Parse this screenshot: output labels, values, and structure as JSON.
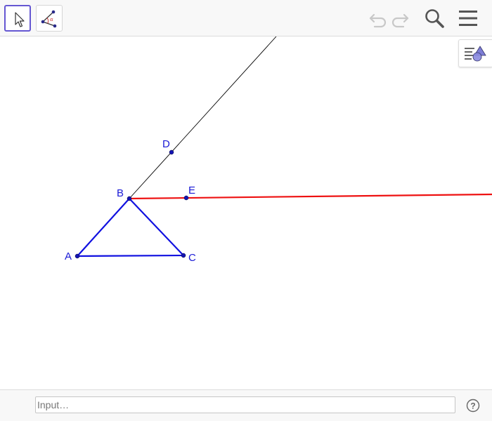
{
  "toolbar": {
    "tools": [
      {
        "name": "move",
        "icon": "arrow-cursor-icon",
        "selected": true
      },
      {
        "name": "angle",
        "icon": "angle-tool-icon",
        "selected": false
      }
    ],
    "actions": [
      {
        "name": "undo",
        "icon": "undo-icon"
      },
      {
        "name": "redo",
        "icon": "redo-icon"
      },
      {
        "name": "search",
        "icon": "search-icon"
      },
      {
        "name": "menu",
        "icon": "hamburger-menu-icon"
      }
    ]
  },
  "style_bar_toggle": {
    "icon": "style-bar-icon"
  },
  "construction": {
    "points": {
      "A": {
        "label": "A"
      },
      "B": {
        "label": "B"
      },
      "C": {
        "label": "C"
      },
      "D": {
        "label": "D"
      },
      "E": {
        "label": "E"
      }
    },
    "objects": [
      {
        "type": "polygon",
        "vertices": [
          "A",
          "B",
          "C"
        ],
        "color": "#1010e0"
      },
      {
        "type": "ray",
        "from": "B",
        "through": "D",
        "color": "#000000"
      },
      {
        "type": "ray",
        "from": "B",
        "through": "E",
        "color": "#ee1111"
      }
    ]
  },
  "input_bar": {
    "placeholder": "Input…",
    "value": "",
    "help_icon": "help-icon"
  },
  "colors": {
    "accent": "#6557d2",
    "point": "#1414b4",
    "label": "#1a1ad6",
    "ray_red": "#ee1111",
    "polygon": "#1010e0"
  }
}
